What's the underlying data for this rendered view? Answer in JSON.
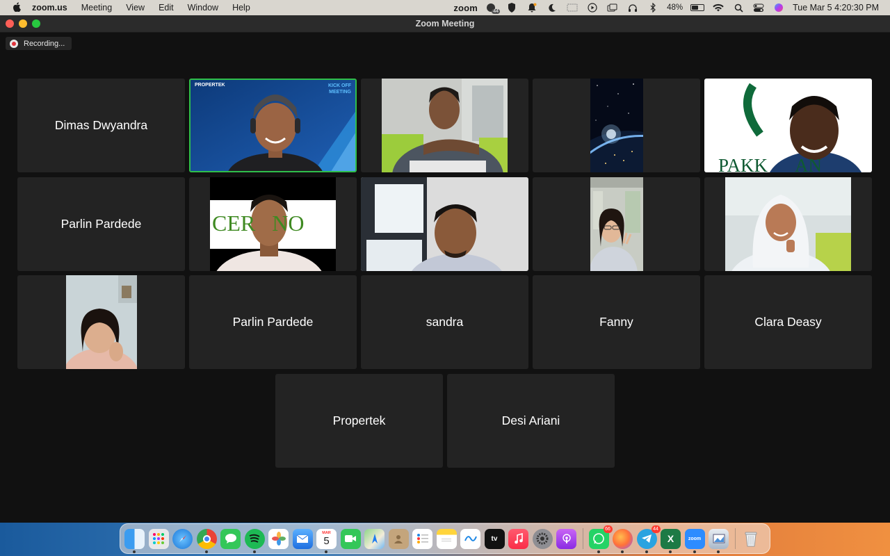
{
  "menubar": {
    "app_name": "zoom.us",
    "menus": [
      "Meeting",
      "View",
      "Edit",
      "Window",
      "Help"
    ],
    "status_app": "zoom",
    "notification_count": "44",
    "battery_percent": "48%",
    "clock": "Tue Mar 5  4:20:30 PM"
  },
  "window": {
    "title": "Zoom Meeting",
    "recording_label": "Recording..."
  },
  "participants": [
    {
      "name": "Dimas Dwyandra",
      "video": false
    },
    {
      "name": "",
      "video": true,
      "active_speaker": true,
      "banner_brand": "PROPERTEK",
      "banner_text": "KICK OFF MEETING"
    },
    {
      "name": "",
      "video": true
    },
    {
      "name": "",
      "video": true
    },
    {
      "name": "",
      "video": true,
      "background_text": "PAKK      AN"
    },
    {
      "name": "Parlin Pardede",
      "video": false
    },
    {
      "name": "",
      "video": true,
      "background_text": "CER   NO"
    },
    {
      "name": "",
      "video": true
    },
    {
      "name": "",
      "video": true
    },
    {
      "name": "",
      "video": true
    },
    {
      "name": "",
      "video": true
    },
    {
      "name": "Parlin Pardede",
      "video": false
    },
    {
      "name": "sandra",
      "video": false
    },
    {
      "name": "Fanny",
      "video": false
    },
    {
      "name": "Clara Deasy",
      "video": false
    },
    {
      "name": "Propertek",
      "video": false
    },
    {
      "name": "Desi Ariani",
      "video": false
    }
  ],
  "dock": {
    "calendar_month": "MAR",
    "calendar_day": "5",
    "appletv_label": "tv",
    "whatsapp_badge": "66",
    "telegram_badge": "44",
    "zoom_label": "zoom",
    "excel_label": "X"
  },
  "colors": {
    "tile_bg": "#232323",
    "active_border": "#2fbf4a",
    "window_bg": "#111111"
  }
}
